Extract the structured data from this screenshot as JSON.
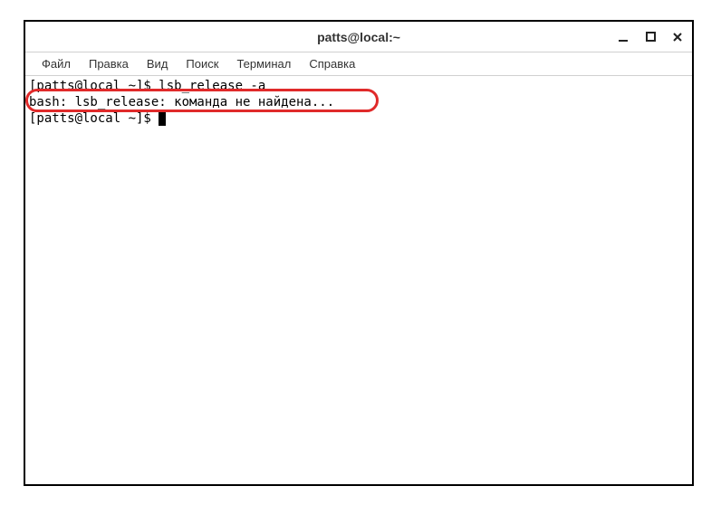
{
  "window": {
    "title": "patts@local:~"
  },
  "menu": {
    "file": "Файл",
    "edit": "Правка",
    "view": "Вид",
    "search": "Поиск",
    "terminal": "Терминал",
    "help": "Справка"
  },
  "terminal": {
    "lines": {
      "0": "[patts@local ~]$ lsb_release -a",
      "1": "bash: lsb_release: команда не найдена...",
      "2": "[patts@local ~]$ "
    }
  }
}
